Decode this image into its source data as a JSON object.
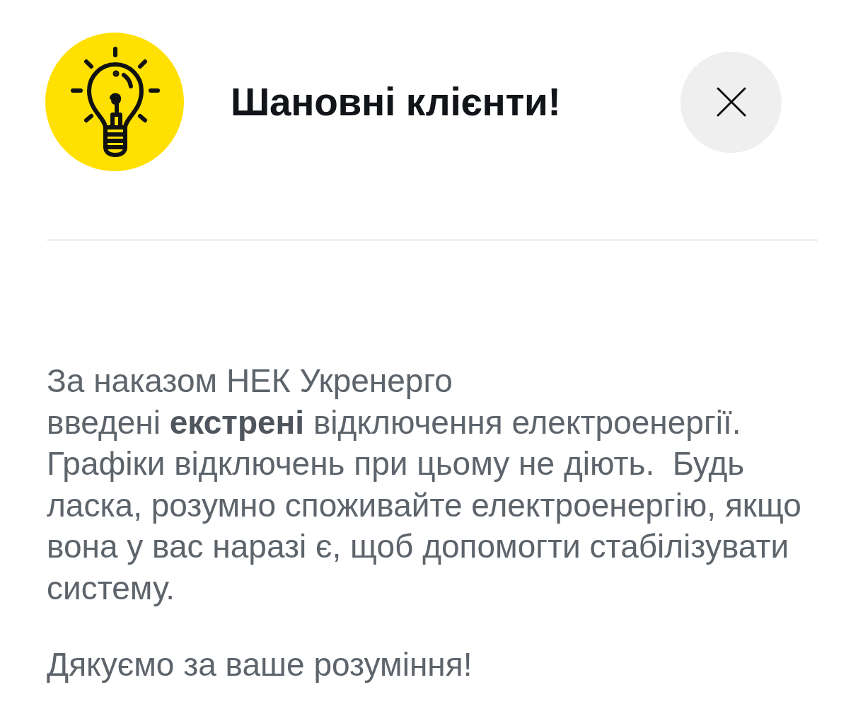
{
  "header": {
    "title": "Шановні клієнти!"
  },
  "message": {
    "paragraphs": [
      {
        "lines": [
          "За наказом НЕК Укренерго",
          "введені **екстрені** відключення електроенергії.",
          "Графіки відключень при цьому не діють.  Будь ласка, розумно споживайте електроенергію, якщо вона у вас наразі є, щоб допомогти стабілізувати систему."
        ]
      },
      {
        "lines": [
          "Дякуємо за ваше розуміння!"
        ]
      }
    ]
  }
}
